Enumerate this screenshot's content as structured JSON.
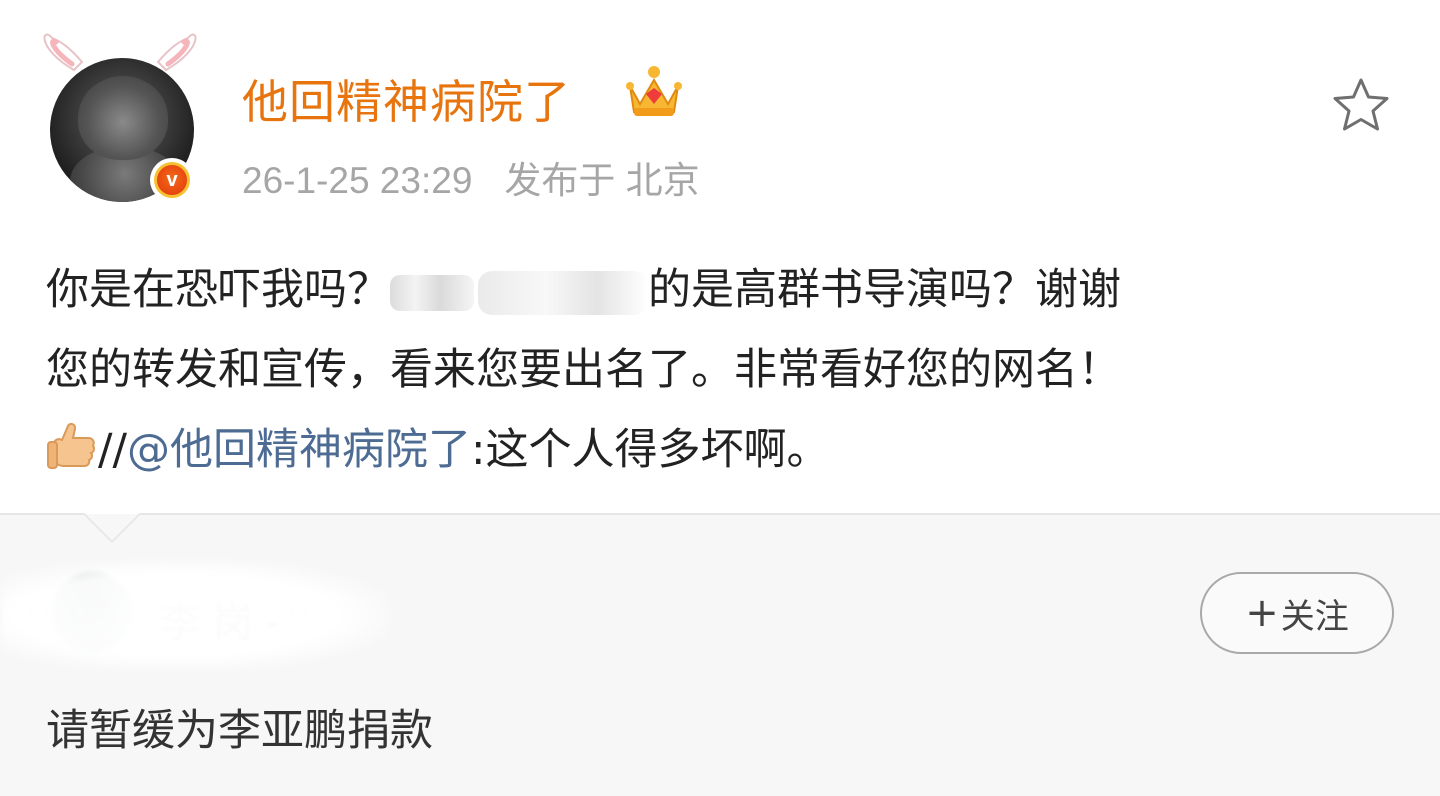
{
  "author": {
    "username": "他回精神病院了",
    "timestamp": "26-1-25 23:29",
    "location": "发布于 北京",
    "badge_icon": "crown-icon",
    "verified_icon": "v-badge-icon"
  },
  "post": {
    "line1_a": "你是在恐吓我吗？",
    "line1_b": "的是高群书导演吗？谢谢",
    "line2": "您的转发和宣传，看来您要出名了。非常看好您的网名！",
    "line3_prefix": "//",
    "line3_mention": "@他回精神病院了",
    "line3_suffix": ":这个人得多坏啊。"
  },
  "retweet": {
    "follow_label": "关注",
    "follow_plus": "+",
    "text": "请暂缓为李亚鹏捐款"
  },
  "colors": {
    "username": "#e8740e",
    "mention": "#4e6c93",
    "meta": "#a6a6a6",
    "lower_bg": "#f7f7f7"
  }
}
